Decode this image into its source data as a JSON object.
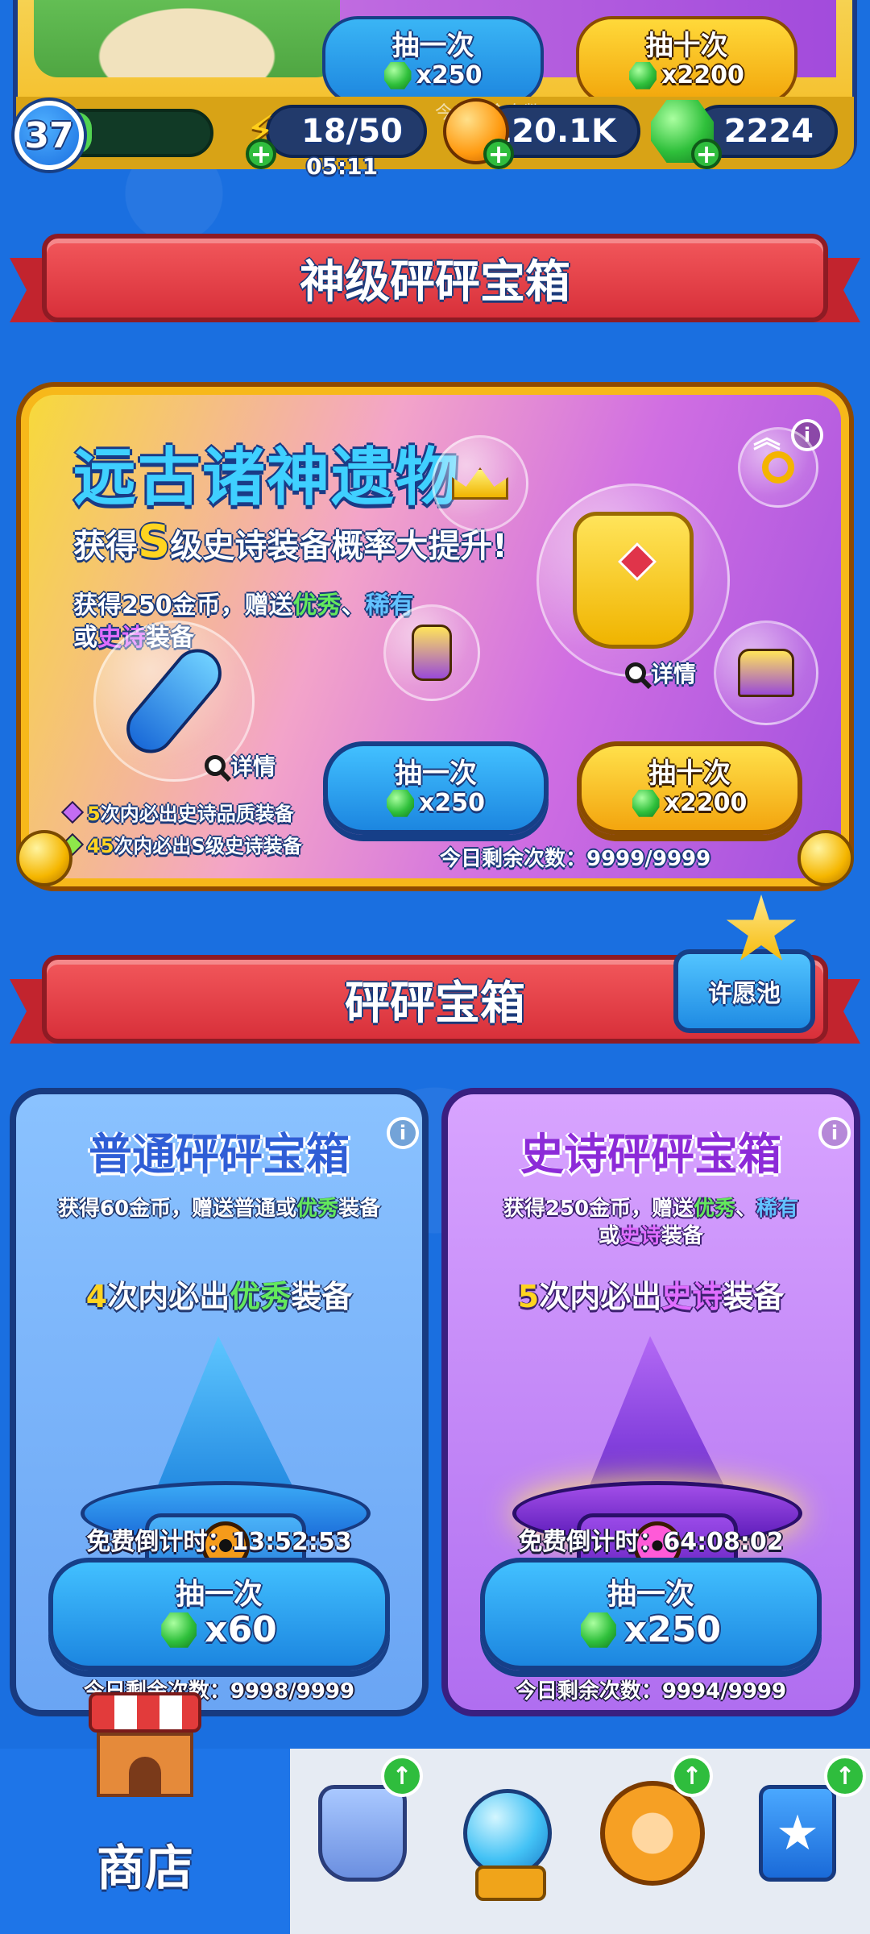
{
  "top": {
    "draw_once_label": "抽一次",
    "draw_once_cost": "x250",
    "draw_ten_label": "抽十次",
    "draw_ten_cost": "x2200",
    "ghost_remaining": "今日剩余次数：9999/9"
  },
  "status": {
    "level": "37",
    "xp_fill_fraction": 0.12,
    "energy": "18/50",
    "energy_timer": "05:11",
    "coins": "120.1K",
    "gems": "2224"
  },
  "god_section": {
    "ribbon_title": "神级砰砰宝箱",
    "card_title": "远古诸神遗物",
    "subtitle_prefix": "获得",
    "subtitle_grade": "S",
    "subtitle_suffix": "级史诗装备概率大提升!",
    "desc_part1": "获得250金币，赠送",
    "desc_excellent": "优秀",
    "desc_sep": "、",
    "desc_rare": "稀有",
    "desc_part2": "或",
    "desc_epic": "史诗",
    "desc_part3": "装备",
    "detail_label": "详情",
    "guarantee1_num": "5",
    "guarantee1_text": "次内必出史诗品质装备",
    "guarantee2_num": "45",
    "guarantee2_text": "次内必出S级史诗装备",
    "draw_once_label": "抽一次",
    "draw_once_cost": "x250",
    "draw_ten_label": "抽十次",
    "draw_ten_cost": "x2200",
    "remaining": "今日剩余次数：9999/9999"
  },
  "chest_section": {
    "ribbon_title": "砰砰宝箱",
    "wish_pool_label": "许愿池"
  },
  "normal_chest": {
    "title": "普通砰砰宝箱",
    "desc_part1": "获得60金币，赠送普通或",
    "desc_excellent": "优秀",
    "desc_part2": "装备",
    "guarantee_num": "4",
    "guarantee_text1": "次内必出",
    "guarantee_quality": "优秀",
    "guarantee_text2": "装备",
    "countdown": "免费倒计时：13:52:53",
    "draw_label": "抽一次",
    "draw_cost": "x60",
    "remaining": "今日剩余次数：9998/9999"
  },
  "epic_chest": {
    "title": "史诗砰砰宝箱",
    "desc_part1": "获得250金币，赠送",
    "desc_excellent": "优秀",
    "desc_sep": "、",
    "desc_rare": "稀有",
    "desc_part2": "或",
    "desc_epic": "史诗",
    "desc_part3": "装备",
    "guarantee_num": "5",
    "guarantee_text1": "次内必出",
    "guarantee_quality": "史诗",
    "guarantee_text2": "装备",
    "countdown": "免费倒计时：64:08:02",
    "draw_label": "抽一次",
    "draw_cost": "x250",
    "remaining": "今日剩余次数：9994/9999"
  },
  "nav": {
    "shop_label": "商店",
    "icons": [
      "shop-icon",
      "armor-icon",
      "crystal-ball-icon",
      "paw-icon",
      "star-card-icon"
    ]
  },
  "colors": {
    "background": "#1a6fe0",
    "ribbon_red": "#d8303a",
    "excellent_green": "#63e85c",
    "rare_blue": "#62c2ff",
    "epic_purple": "#e06dff",
    "gold": "#ffd420"
  }
}
